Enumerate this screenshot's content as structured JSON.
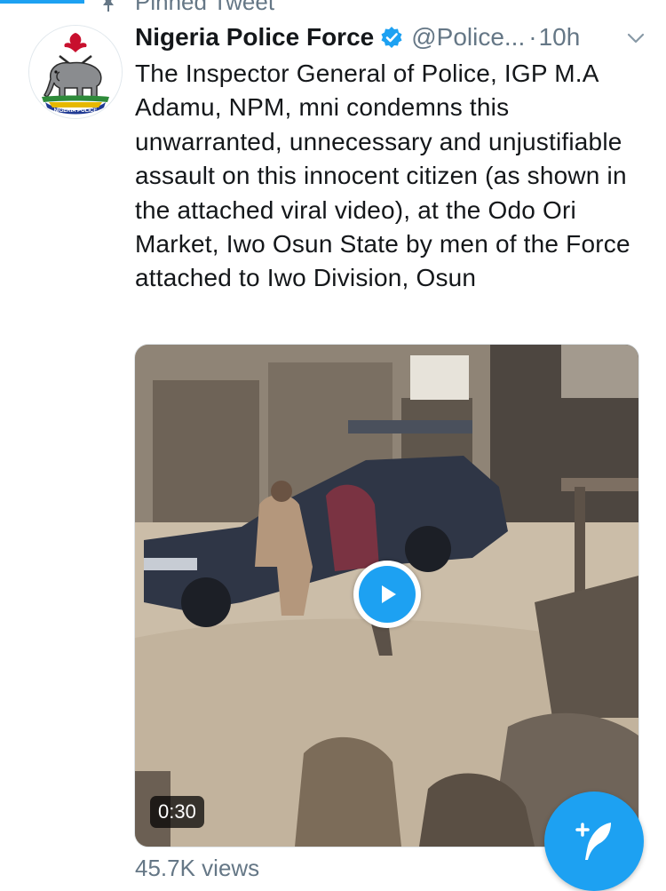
{
  "pinned": {
    "label": "Pinned Tweet"
  },
  "tweet": {
    "author_name": "Nigeria Police Force",
    "handle": "@Police...",
    "separator": "·",
    "time": "10h",
    "text": "The Inspector General of Police, IGP M.A Adamu, NPM, mni condemns this unwarranted, unnecessary and unjustifiable assault on this innocent citizen (as shown in the attached viral video), at the Odo Ori Market, Iwo Osun State by men of the Force attached to Iwo Division, Osun",
    "avatar_logo_text": "NIGERIA POLICE"
  },
  "media": {
    "duration": "0:30"
  },
  "stats": {
    "views": "45.7K views"
  },
  "icons": {
    "pin": "pin-icon",
    "verified": "verified-badge-icon",
    "caret": "chevron-down-icon",
    "play": "play-icon",
    "compose": "compose-tweet-icon"
  },
  "colors": {
    "accent": "#1da1f2",
    "text": "#14171a",
    "muted": "#657786"
  }
}
